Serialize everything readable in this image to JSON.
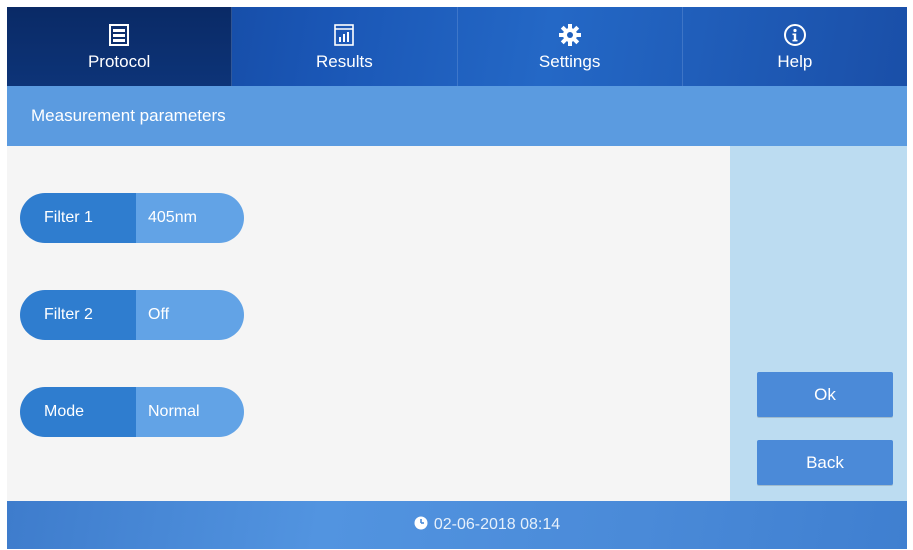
{
  "nav": {
    "tabs": [
      {
        "label": "Protocol",
        "icon": "protocol-icon",
        "active": true
      },
      {
        "label": "Results",
        "icon": "results-icon",
        "active": false
      },
      {
        "label": "Settings",
        "icon": "gear-icon",
        "active": false
      },
      {
        "label": "Help",
        "icon": "info-icon",
        "active": false
      }
    ]
  },
  "header": {
    "title": "Measurement parameters"
  },
  "params": [
    {
      "label": "Filter 1",
      "value": "405nm"
    },
    {
      "label": "Filter 2",
      "value": "Off"
    },
    {
      "label": "Mode",
      "value": "Normal"
    }
  ],
  "buttons": {
    "ok": "Ok",
    "back": "Back"
  },
  "footer": {
    "datetime": "02-06-2018 08:14",
    "icon": "clock-icon"
  },
  "colors": {
    "nav_bg": "#1a56b5",
    "header_bg": "#5b9be0",
    "pill_label": "#2f7dcf",
    "pill_value": "#62a3e6",
    "button_bg": "#4b8ad8",
    "side_panel": "#bcdcf1"
  }
}
